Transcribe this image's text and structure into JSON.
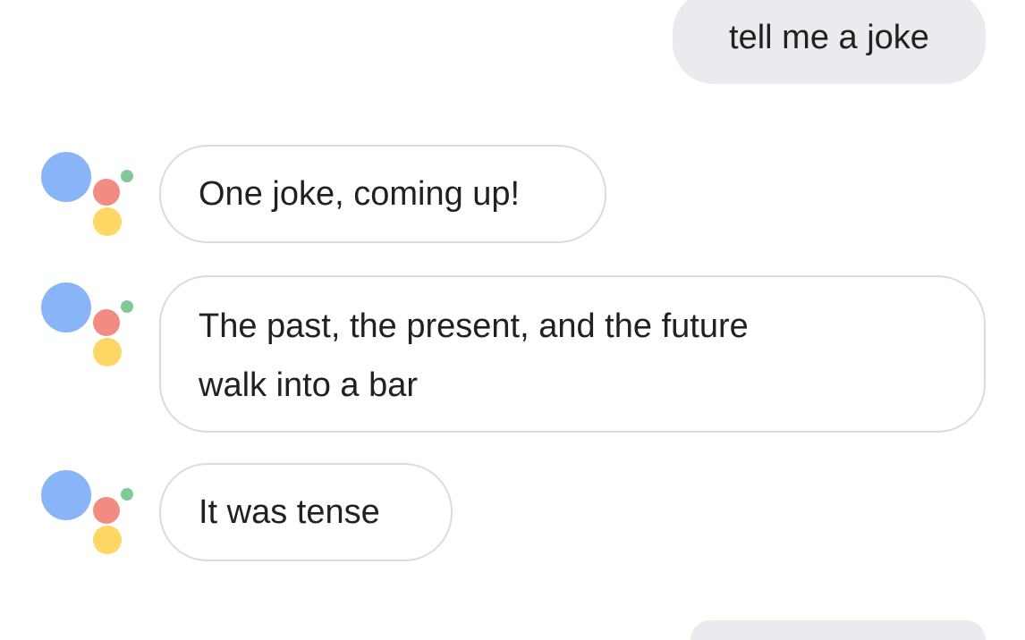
{
  "conversation": {
    "user_message_1": "tell me a joke",
    "assistant_message_1": "One joke, coming up!",
    "assistant_message_2_line_1": "The past, the present, and the future",
    "assistant_message_2_line_2": "walk into a bar",
    "assistant_message_3": "It was tense"
  },
  "assistant_logo": {
    "icon": "google-assistant-logo-icon",
    "colors": {
      "blue": "#8ab4f8",
      "red": "#f28b82",
      "yellow": "#fdd663",
      "green": "#81c995"
    }
  },
  "colors": {
    "user_bubble_bg": "#e9ebee",
    "assistant_bubble_border": "#dcdcdc",
    "text": "#212121"
  }
}
